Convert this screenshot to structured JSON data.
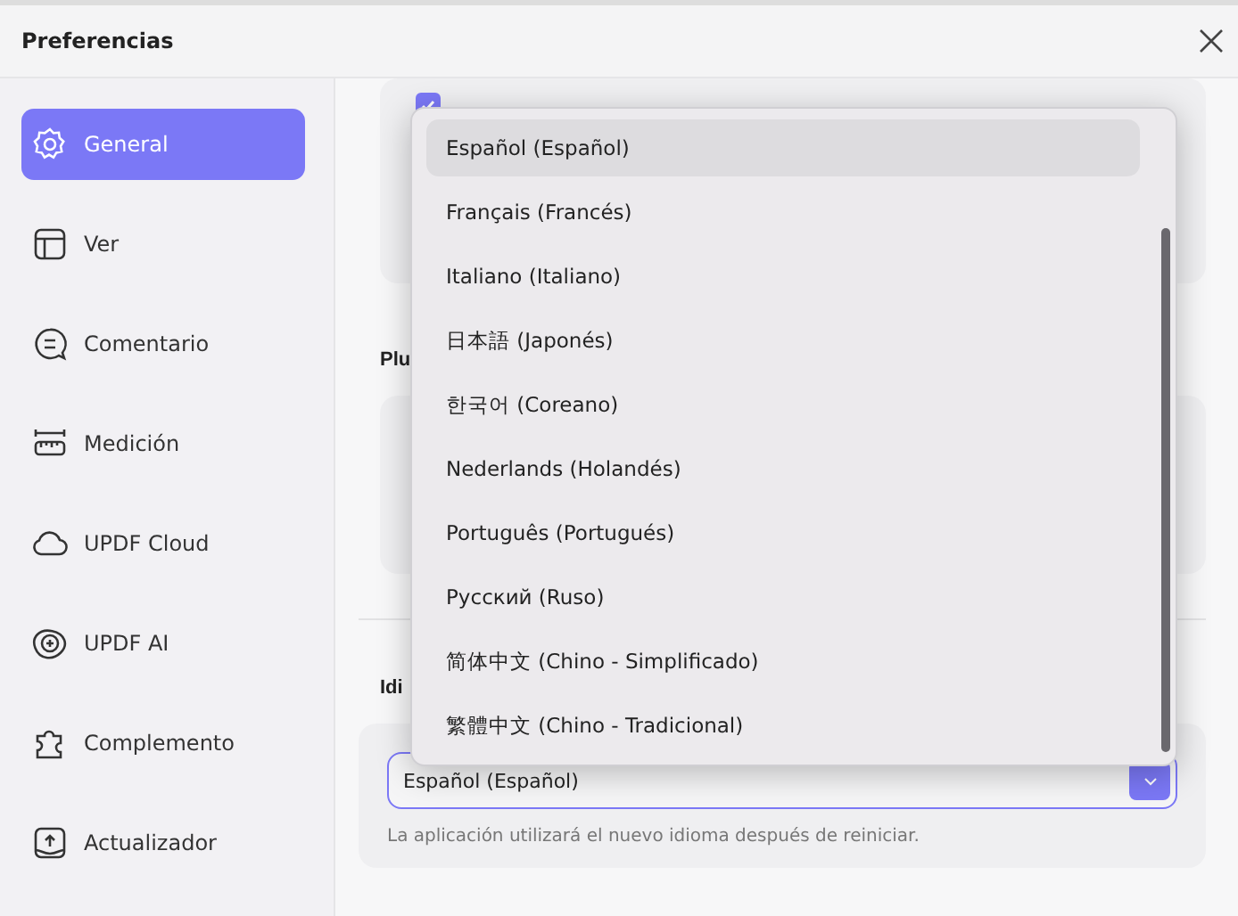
{
  "window": {
    "title": "Preferencias"
  },
  "sidebar": {
    "items": [
      {
        "label": "General",
        "selected": true
      },
      {
        "label": "Ver",
        "selected": false
      },
      {
        "label": "Comentario",
        "selected": false
      },
      {
        "label": "Medición",
        "selected": false
      },
      {
        "label": "UPDF Cloud",
        "selected": false
      },
      {
        "label": "UPDF AI",
        "selected": false
      },
      {
        "label": "Complemento",
        "selected": false
      },
      {
        "label": "Actualizador",
        "selected": false
      }
    ]
  },
  "content": {
    "checkbox": {
      "checked": true
    },
    "section_1": {
      "heading": "Plu"
    },
    "section_2": {
      "heading": "Idi",
      "select": {
        "value": "Español (Español)"
      },
      "note": "La aplicación utilizará el nuevo idioma después de reiniciar."
    }
  },
  "dropdown": {
    "options": [
      {
        "label": "Español (Español)",
        "selected": true
      },
      {
        "label": "Français (Francés)",
        "selected": false
      },
      {
        "label": "Italiano (Italiano)",
        "selected": false
      },
      {
        "label": "日本語 (Japonés)",
        "selected": false
      },
      {
        "label": "한국어 (Coreano)",
        "selected": false
      },
      {
        "label": "Nederlands (Holandés)",
        "selected": false
      },
      {
        "label": "Português (Portugués)",
        "selected": false
      },
      {
        "label": "Русский (Ruso)",
        "selected": false
      },
      {
        "label": "简体中文 (Chino - Simplificado)",
        "selected": false
      },
      {
        "label": "繁體中文 (Chino - Tradicional)",
        "selected": false
      }
    ]
  }
}
